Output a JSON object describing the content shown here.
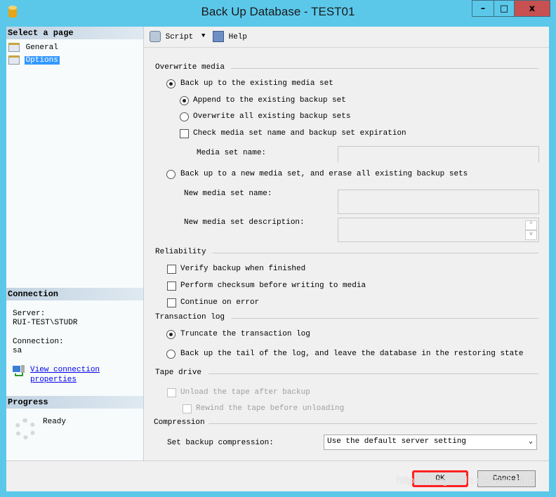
{
  "window": {
    "title": "Back Up Database - TEST01",
    "minimize": "–",
    "maximize": "□",
    "close": "x"
  },
  "left": {
    "select_header": "Select a page",
    "pages": [
      {
        "label": "General",
        "selected": false
      },
      {
        "label": "Options",
        "selected": true
      }
    ],
    "connection_header": "Connection",
    "server_label": "Server:",
    "server_value": "RUI-TEST\\STUDR",
    "connection_label": "Connection:",
    "connection_value": "sa",
    "view_link_1": "View connection ",
    "view_link_2": "properties",
    "progress_header": "Progress",
    "progress_status": "Ready"
  },
  "toolbar": {
    "script": "Script",
    "help": "Help"
  },
  "overwrite": {
    "title": "Overwrite media",
    "existing": "Back up to the existing media set",
    "append": "Append to the existing backup set",
    "overwrite_all": "Overwrite all existing backup sets",
    "check_name": "Check media set name and backup set expiration",
    "media_set_name": "Media set name:",
    "new_set": "Back up to a new media set, and erase all existing backup sets",
    "new_name": "New media set name:",
    "new_desc": "New media set description:"
  },
  "reliability": {
    "title": "Reliability",
    "verify": "Verify backup when finished",
    "checksum": "Perform checksum before writing to media",
    "continue": "Continue on error"
  },
  "txlog": {
    "title": "Transaction log",
    "truncate": "Truncate the transaction log",
    "tail": "Back up the tail of the log, and leave the database in the restoring state"
  },
  "tape": {
    "title": "Tape drive",
    "unload": "Unload the tape after backup",
    "rewind": "Rewind the tape before unloading"
  },
  "compression": {
    "title": "Compression",
    "label": "Set backup compression:",
    "value": "Use the default server setting"
  },
  "buttons": {
    "ok": "OK",
    "cancel": "Cancel"
  },
  "watermark": "https://blog.csdn.net/Ruishine",
  "colors": {
    "titlebar": "#5bc8ea",
    "close": "#c75050",
    "selection": "#3399ff",
    "highlight_border": "#ff0000"
  }
}
